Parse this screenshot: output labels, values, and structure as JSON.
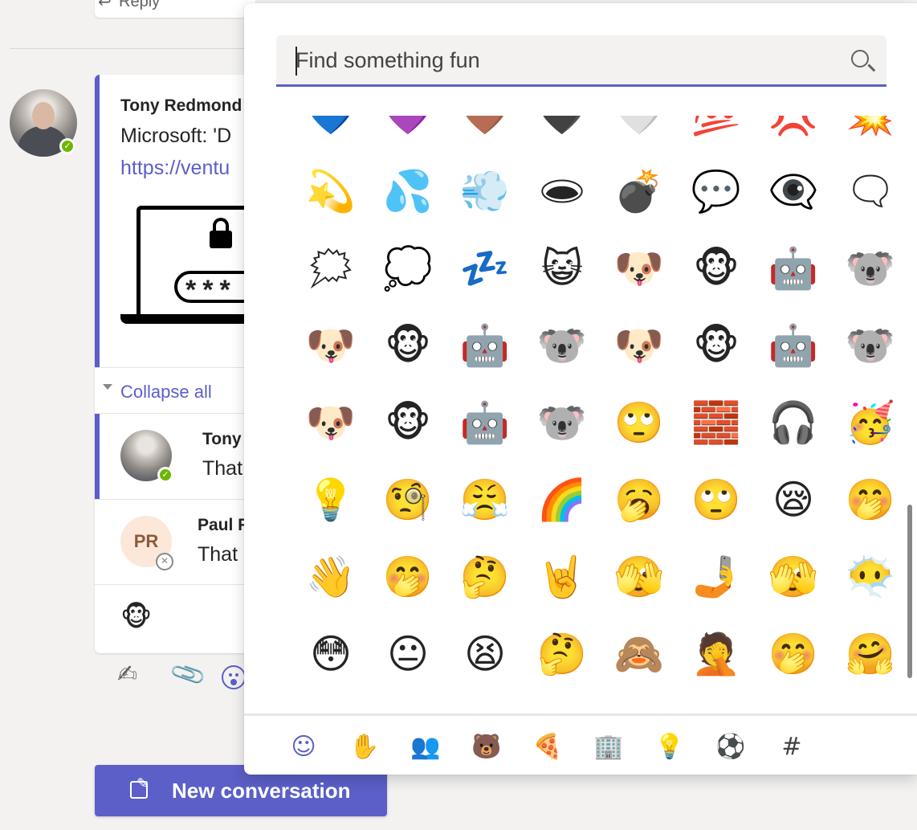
{
  "background": {
    "reply_label": "Reply",
    "post": {
      "author": "Tony Redmond",
      "title": "Microsoft: 'D",
      "link": "https://ventu",
      "password_mask": "***"
    },
    "collapse_label": "Collapse all",
    "replies": [
      {
        "name": "Tony",
        "text": "That",
        "initials": ""
      },
      {
        "name": "Paul F",
        "text": "That",
        "initials": "PR"
      }
    ],
    "new_conversation_label": "New conversation"
  },
  "picker": {
    "search_placeholder": "Find something fun",
    "emoji_rows": [
      [
        "💙",
        "💜",
        "🤎",
        "🖤",
        "🤍",
        "💯",
        "💢",
        "💥"
      ],
      [
        "💫",
        "💦",
        "💨",
        "🕳",
        "💣",
        "💬",
        "👁‍🗨",
        "🗨"
      ],
      [
        "🗯",
        "💭",
        "💤",
        "😺",
        "🐶",
        "🐵",
        "🤖",
        "🐨"
      ],
      [
        "🐶",
        "🐵",
        "🤖",
        "🐨",
        "🐶",
        "🐵",
        "🤖",
        "🐨"
      ],
      [
        "🐶",
        "🐵",
        "🤖",
        "🐨",
        "🙄",
        "🧱",
        "🎧",
        "🥳"
      ],
      [
        "💡",
        "🧐",
        "😤",
        "🌈",
        "🥱",
        "🙄",
        "😪",
        "🤭"
      ],
      [
        "👋",
        "🤭",
        "🤔",
        "🤘",
        "🫣",
        "🤳",
        "🫣",
        "😶‍🌫️"
      ],
      [
        "😳",
        "😐",
        "😫",
        "🤔",
        "🙈",
        "🤦",
        "🤭",
        "🤗"
      ]
    ],
    "categories": [
      {
        "icon": "smiley-icon",
        "glyph": "☺"
      },
      {
        "icon": "hand-icon",
        "glyph": "✋"
      },
      {
        "icon": "people-icon",
        "glyph": "👥"
      },
      {
        "icon": "bear-icon",
        "glyph": "🐻"
      },
      {
        "icon": "pizza-icon",
        "glyph": "🍕"
      },
      {
        "icon": "building-icon",
        "glyph": "🏢"
      },
      {
        "icon": "lightbulb-icon",
        "glyph": "💡"
      },
      {
        "icon": "soccer-ball-icon",
        "glyph": "⚽"
      },
      {
        "icon": "hashtag-icon",
        "glyph": "#"
      }
    ]
  },
  "colors": {
    "accent": "#5b5fc7",
    "presence_available": "#6bb700"
  }
}
